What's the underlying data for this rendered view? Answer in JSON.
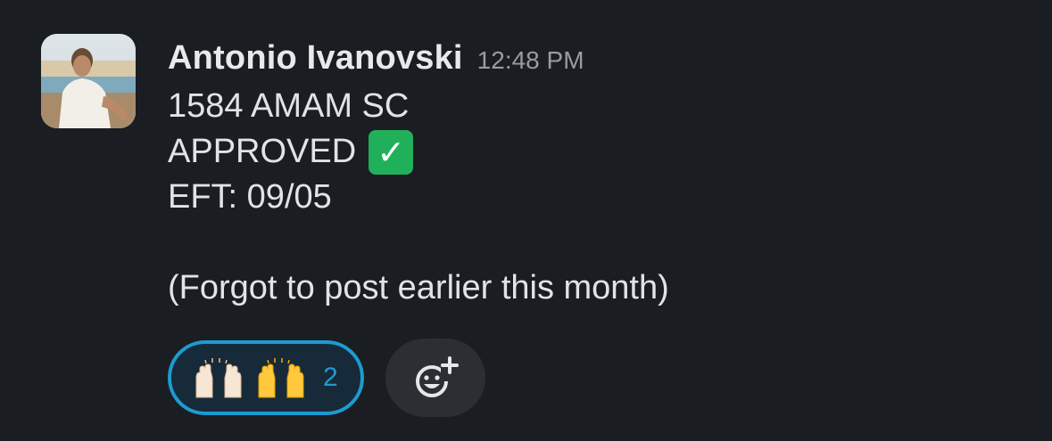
{
  "message": {
    "author": "Antonio Ivanovski",
    "timestamp": "12:48 PM",
    "lines": {
      "line1": "1584 AMAM SC",
      "line2": "APPROVED",
      "line2_emoji": "✓",
      "line3": "EFT: 09/05",
      "line5": "(Forgot to post earlier this month)"
    }
  },
  "reactions": {
    "raised_hands": {
      "emojis": [
        "raising-hands-light",
        "raising-hands-yellow"
      ],
      "count": "2"
    },
    "add_reaction_icon": "add-emoji-icon"
  },
  "colors": {
    "background": "#1a1d21",
    "accent": "#1d9bd1",
    "check_green": "#21b05a"
  }
}
